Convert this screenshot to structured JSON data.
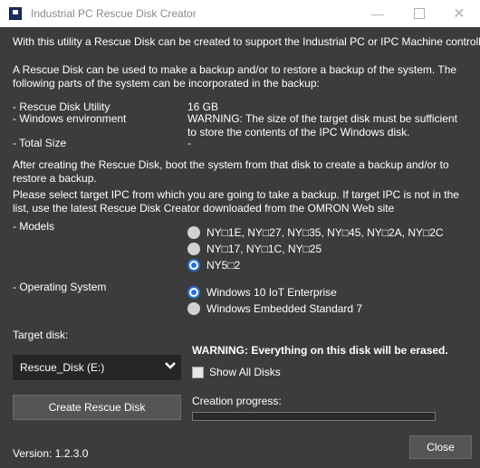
{
  "window": {
    "title": "Industrial PC Rescue Disk Creator",
    "controls": {
      "minimize": "—",
      "close": "✕"
    }
  },
  "intro": "With this utility a Rescue Disk can be created to support the Industrial PC or IPC Machine controller",
  "backup_intro": "A Rescue Disk can be used to make a backup and/or to restore a backup of the system.  The following parts of the system can be incorporated in the backup:",
  "parts": {
    "utility_label": "- Rescue Disk Utility",
    "utility_value": "16 GB",
    "windows_label": "- Windows environment",
    "windows_value": "WARNING:  The size of the target disk must be sufficient to store the contents of the IPC Windows disk.",
    "total_label": "- Total Size",
    "total_value": "-"
  },
  "after_text": "After creating the Rescue Disk, boot the system from that disk to create a backup and/or to restore a backup.",
  "select_text": "Please select target IPC from which you are going to take a backup. If target IPC is not in the list, use the latest Rescue Disk Creator downloaded from the OMRON Web site",
  "models": {
    "label": "- Models",
    "options": [
      {
        "label": "NY□1E, NY□27, NY□35, NY□45, NY□2A, NY□2C",
        "checked": false
      },
      {
        "label": "NY□17, NY□1C, NY□25",
        "checked": false
      },
      {
        "label": "NY5□2",
        "checked": true
      }
    ]
  },
  "os": {
    "label": "- Operating System",
    "options": [
      {
        "label": "Windows 10 IoT Enterprise",
        "checked": true
      },
      {
        "label": "Windows Embedded Standard 7",
        "checked": false
      }
    ]
  },
  "target": {
    "label": "Target disk:",
    "selected": "Rescue_Disk (E:)",
    "warning": "WARNING:  Everything on this disk will be erased.",
    "show_all_label": "Show All Disks",
    "show_all_checked": false
  },
  "actions": {
    "create_label": "Create Rescue Disk",
    "progress_label": "Creation progress:",
    "progress_value": 0,
    "close_label": "Close"
  },
  "version": "Version:  1.2.3.0",
  "colors": {
    "background": "#3c3c3c",
    "accent": "#2b6fd6",
    "text": "#ffffff"
  }
}
